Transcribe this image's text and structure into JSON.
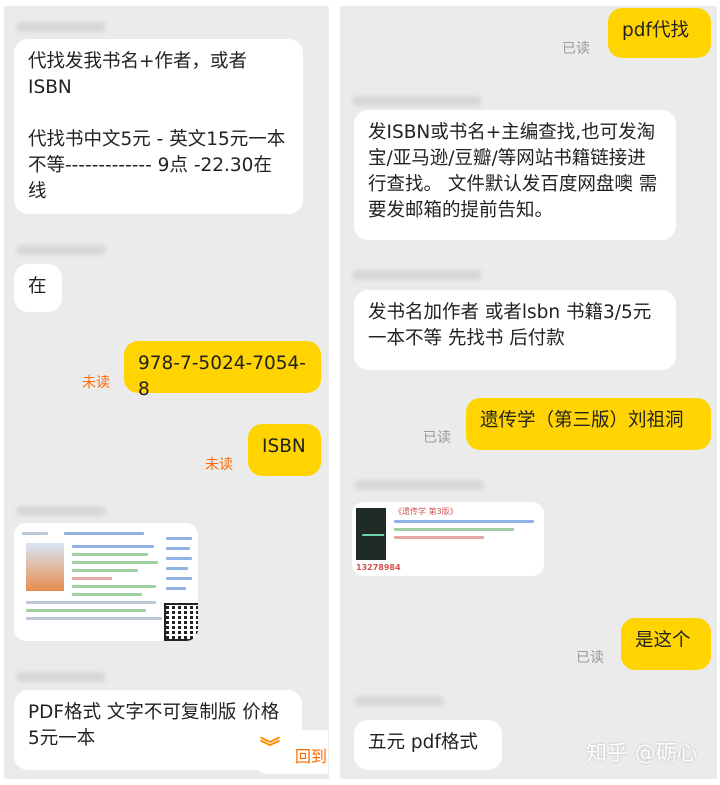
{
  "left": {
    "messages": [
      {
        "text": "代找发我书名+作者，或者ISBN\n\n 代找书中文5元 - 英文15元一本不等------------- 9点 -22.30在线"
      },
      {
        "text": "在"
      },
      {
        "text": "978-7-5024-7054-8",
        "status": "未读"
      },
      {
        "text": "ISBN",
        "status": "未读"
      },
      {
        "text": "PDF格式  文字不可复制版  价格5元一本"
      }
    ],
    "scroll_back_label": "回到"
  },
  "right": {
    "messages": [
      {
        "text": "pdf代找",
        "status": "已读"
      },
      {
        "text": "发ISBN或书名+主编查找,也可发淘宝/亚马逊/豆瓣/等网站书籍链接进行查找。 文件默认发百度网盘噢  需要发邮箱的提前告知。"
      },
      {
        "text": "发书名加作者 或者lsbn  书籍3/5元一本不等  先找书 后付款"
      },
      {
        "text": "遗传学（第三版）刘祖洞",
        "status": "已读"
      },
      {
        "text": "是这个",
        "status": "已读"
      },
      {
        "text": "五元 pdf格式"
      }
    ],
    "card": {
      "title": "《遗传学 第3版》",
      "price": "13278984"
    }
  },
  "watermark": {
    "brand": "知乎",
    "author": "@砺心"
  },
  "colors": {
    "outgoing": "#ffd400",
    "incoming": "#ffffff",
    "unread": "#ff6a00",
    "read": "#9a9a9a",
    "panel": "#ebebeb"
  }
}
